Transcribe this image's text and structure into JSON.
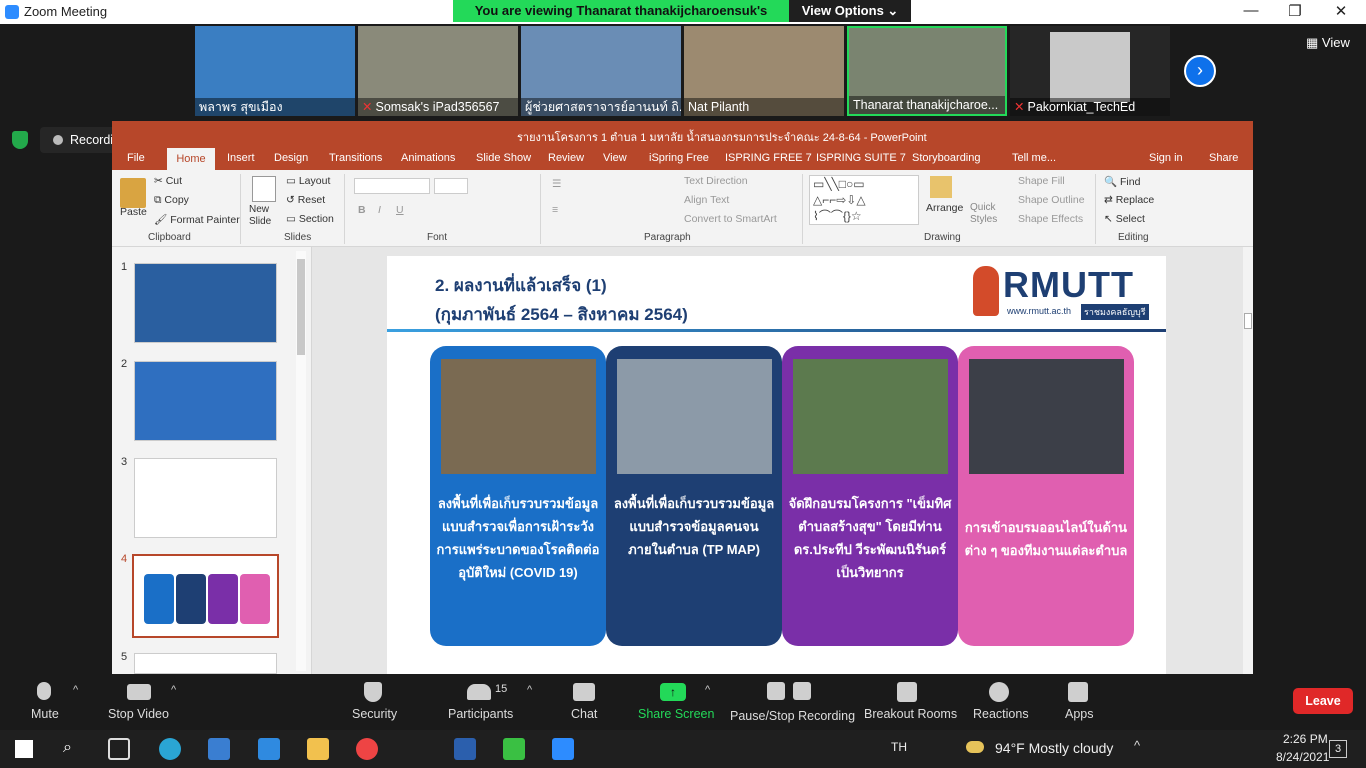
{
  "window": {
    "title": "Zoom Meeting",
    "viewing_banner": "You are viewing Thanarat thanakijcharoensuk's screen",
    "view_options": "View Options",
    "view_label": "View"
  },
  "participants": [
    "พลาพร สุขเมือง",
    "Somsak's iPad356567",
    "ผู้ช่วยศาสตราจารย์อานนท์ ถิ...",
    "Nat Pilanth",
    "Thanarat thanakijcharoe...",
    "Pakornkiat_TechEd"
  ],
  "recording": "Recording...",
  "ppt": {
    "title": "รายงานโครงการ 1 ตำบล 1 มหาลัย น้ำสนองกรมการประจำคณะ 24-8-64 - PowerPoint",
    "tabs": [
      "File",
      "Home",
      "Insert",
      "Design",
      "Transitions",
      "Animations",
      "Slide Show",
      "Review",
      "View",
      "iSpring Free",
      "ISPRING FREE 7",
      "ISPRING SUITE 7",
      "Storyboarding",
      "Tell me...",
      "Sign in",
      "Share"
    ],
    "clipboard": {
      "paste": "Paste",
      "cut": "Cut",
      "copy": "Copy",
      "format_painter": "Format Painter",
      "group": "Clipboard"
    },
    "slides_grp": {
      "new_slide": "New Slide",
      "layout": "Layout",
      "reset": "Reset",
      "section": "Section",
      "group": "Slides"
    },
    "font_group": "Font",
    "paragraph": {
      "text_direction": "Text Direction",
      "align_text": "Align Text",
      "convert": "Convert to SmartArt",
      "group": "Paragraph"
    },
    "drawing": {
      "arrange": "Arrange",
      "quick_styles": "Quick Styles",
      "shape_fill": "Shape Fill",
      "shape_outline": "Shape Outline",
      "shape_effects": "Shape Effects",
      "group": "Drawing"
    },
    "editing": {
      "find": "Find",
      "replace": "Replace",
      "select": "Select",
      "group": "Editing"
    },
    "slide_numbers": [
      "1",
      "2",
      "3",
      "4",
      "5"
    ],
    "slide": {
      "title_line1": "2. ผลงานที่แล้วเสร็จ (1)",
      "title_line2": "(กุมภาพันธ์ 2564 – สิงหาคม 2564)",
      "logo": "RMUTT",
      "logo_url": "www.rmutt.ac.th",
      "logo_tag": "ราชมงคลธัญบุรี",
      "panels": [
        {
          "text": "ลงพื้นที่เพื่อเก็บรวบรวมข้อมูลแบบสำรวจเพื่อการเฝ้าระวังการแพร่ระบาดของโรคติดต่ออุบัติใหม่ (COVID 19)",
          "color": "#1a6fc7"
        },
        {
          "text": "ลงพื้นที่เพื่อเก็บรวบรวมข้อมูลแบบสำรวจข้อมูลคนจนภายในตำบล (TP MAP)",
          "color": "#1e3f73"
        },
        {
          "text": "จัดฝึกอบรมโครงการ \"เข็มทิศตำบลสร้างสุข\" โดยมีท่าน ดร.ประทีป วีระพัฒนนิรันดร์ เป็นวิทยากร",
          "color": "#7a2fa8"
        },
        {
          "text": "การเข้าอบรมออนไลน์ในด้านต่าง ๆ ของทีมงานแต่ละตำบล",
          "color": "#e05fb0"
        }
      ]
    }
  },
  "toolbar": {
    "mute": "Mute",
    "stop_video": "Stop Video",
    "security": "Security",
    "participants": "Participants",
    "participants_count": "15",
    "chat": "Chat",
    "share_screen": "Share Screen",
    "pause_recording": "Pause/Stop Recording",
    "breakout": "Breakout Rooms",
    "reactions": "Reactions",
    "apps": "Apps",
    "leave": "Leave"
  },
  "taskbar": {
    "lang": "TH",
    "weather": "94°F  Mostly cloudy",
    "time": "2:26 PM",
    "date": "8/24/2021",
    "notif": "3"
  }
}
